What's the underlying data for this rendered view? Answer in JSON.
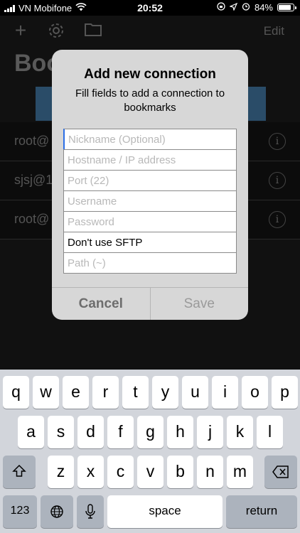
{
  "status_bar": {
    "carrier": "VN Mobifone",
    "time": "20:52",
    "battery_percent": "84%",
    "battery_level": 0.84
  },
  "app": {
    "edit_label": "Edit",
    "title": "Boo",
    "rows": [
      {
        "label": "root@"
      },
      {
        "label": "sjsj@1"
      },
      {
        "label": "root@"
      }
    ]
  },
  "dialog": {
    "title": "Add new connection",
    "message": "Fill fields to add a connection to bookmarks",
    "fields": {
      "nickname_placeholder": "Nickname (Optional)",
      "hostname_placeholder": "Hostname / IP address",
      "port_placeholder": "Port (22)",
      "username_placeholder": "Username",
      "password_placeholder": "Password",
      "sftp_value": "Don't use SFTP",
      "path_placeholder": "Path (~)"
    },
    "cancel_label": "Cancel",
    "save_label": "Save"
  },
  "keyboard": {
    "row1": [
      "q",
      "w",
      "e",
      "r",
      "t",
      "y",
      "u",
      "i",
      "o",
      "p"
    ],
    "row2": [
      "a",
      "s",
      "d",
      "f",
      "g",
      "h",
      "j",
      "k",
      "l"
    ],
    "row3": [
      "z",
      "x",
      "c",
      "v",
      "b",
      "n",
      "m"
    ],
    "numbers_label": "123",
    "space_label": "space",
    "return_label": "return"
  },
  "colors": {
    "accent": "#2b6ee6",
    "dialog_bg": "#d7d7d7",
    "keyboard_bg": "#d2d5db"
  }
}
